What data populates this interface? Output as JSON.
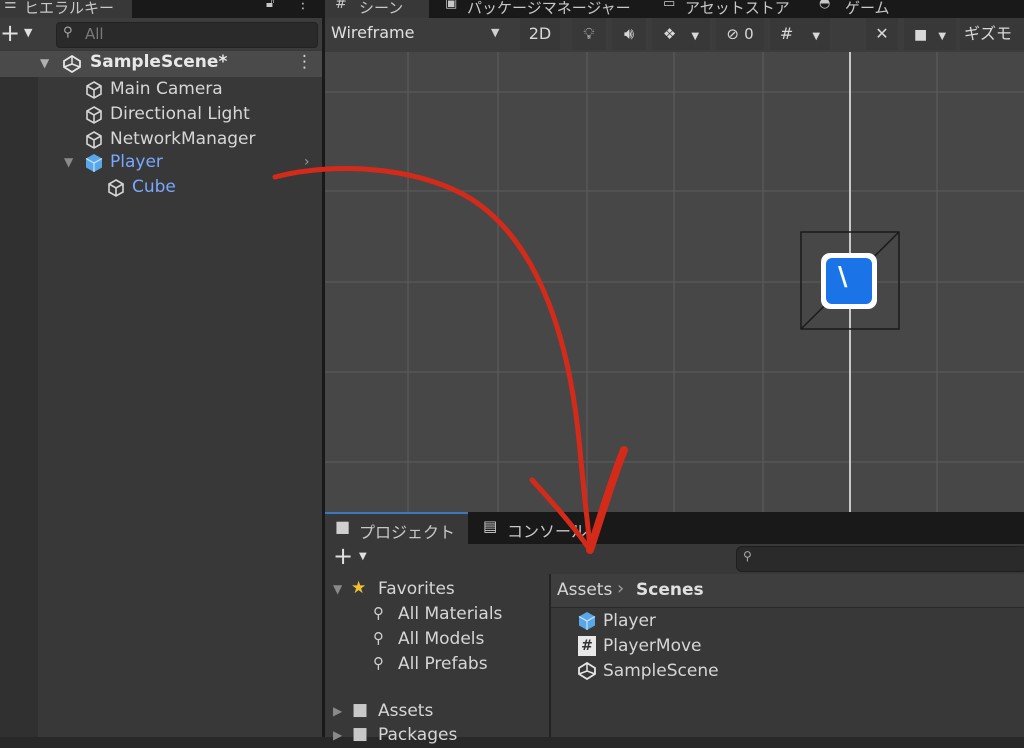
{
  "hierarchy": {
    "tab_label": "ヒエラルキー",
    "search_placeholder": "All",
    "scene_name": "SampleScene*",
    "items": [
      {
        "label": "Main Camera"
      },
      {
        "label": "Directional Light"
      },
      {
        "label": "NetworkManager"
      },
      {
        "label": "Player"
      },
      {
        "label": "Cube"
      }
    ]
  },
  "top_tabs": {
    "scene": "シーン",
    "package_manager": "パッケージマネージャー",
    "asset_store": "アセットストア",
    "game": "ゲーム"
  },
  "scene_toolbar": {
    "draw_mode": "Wireframe",
    "mode_2d": "2D",
    "hidden_count": "0",
    "gizmos": "ギズモ"
  },
  "project": {
    "tab_project": "プロジェクト",
    "tab_console": "コンソール",
    "search_placeholder": "",
    "favorites": {
      "label": "Favorites",
      "items": [
        {
          "label": "All Materials"
        },
        {
          "label": "All Models"
        },
        {
          "label": "All Prefabs"
        }
      ]
    },
    "folders": [
      {
        "label": "Assets"
      },
      {
        "label": "Packages"
      }
    ],
    "breadcrumb": {
      "root": "Assets",
      "current": "Scenes"
    },
    "files": [
      {
        "label": "Player"
      },
      {
        "label": "PlayerMove"
      },
      {
        "label": "SampleScene"
      }
    ]
  },
  "colors": {
    "annotation_arrow": "#d42a1a",
    "prefab_blue": "#7aa8ff",
    "gizmo_blue": "#1a74e8"
  }
}
